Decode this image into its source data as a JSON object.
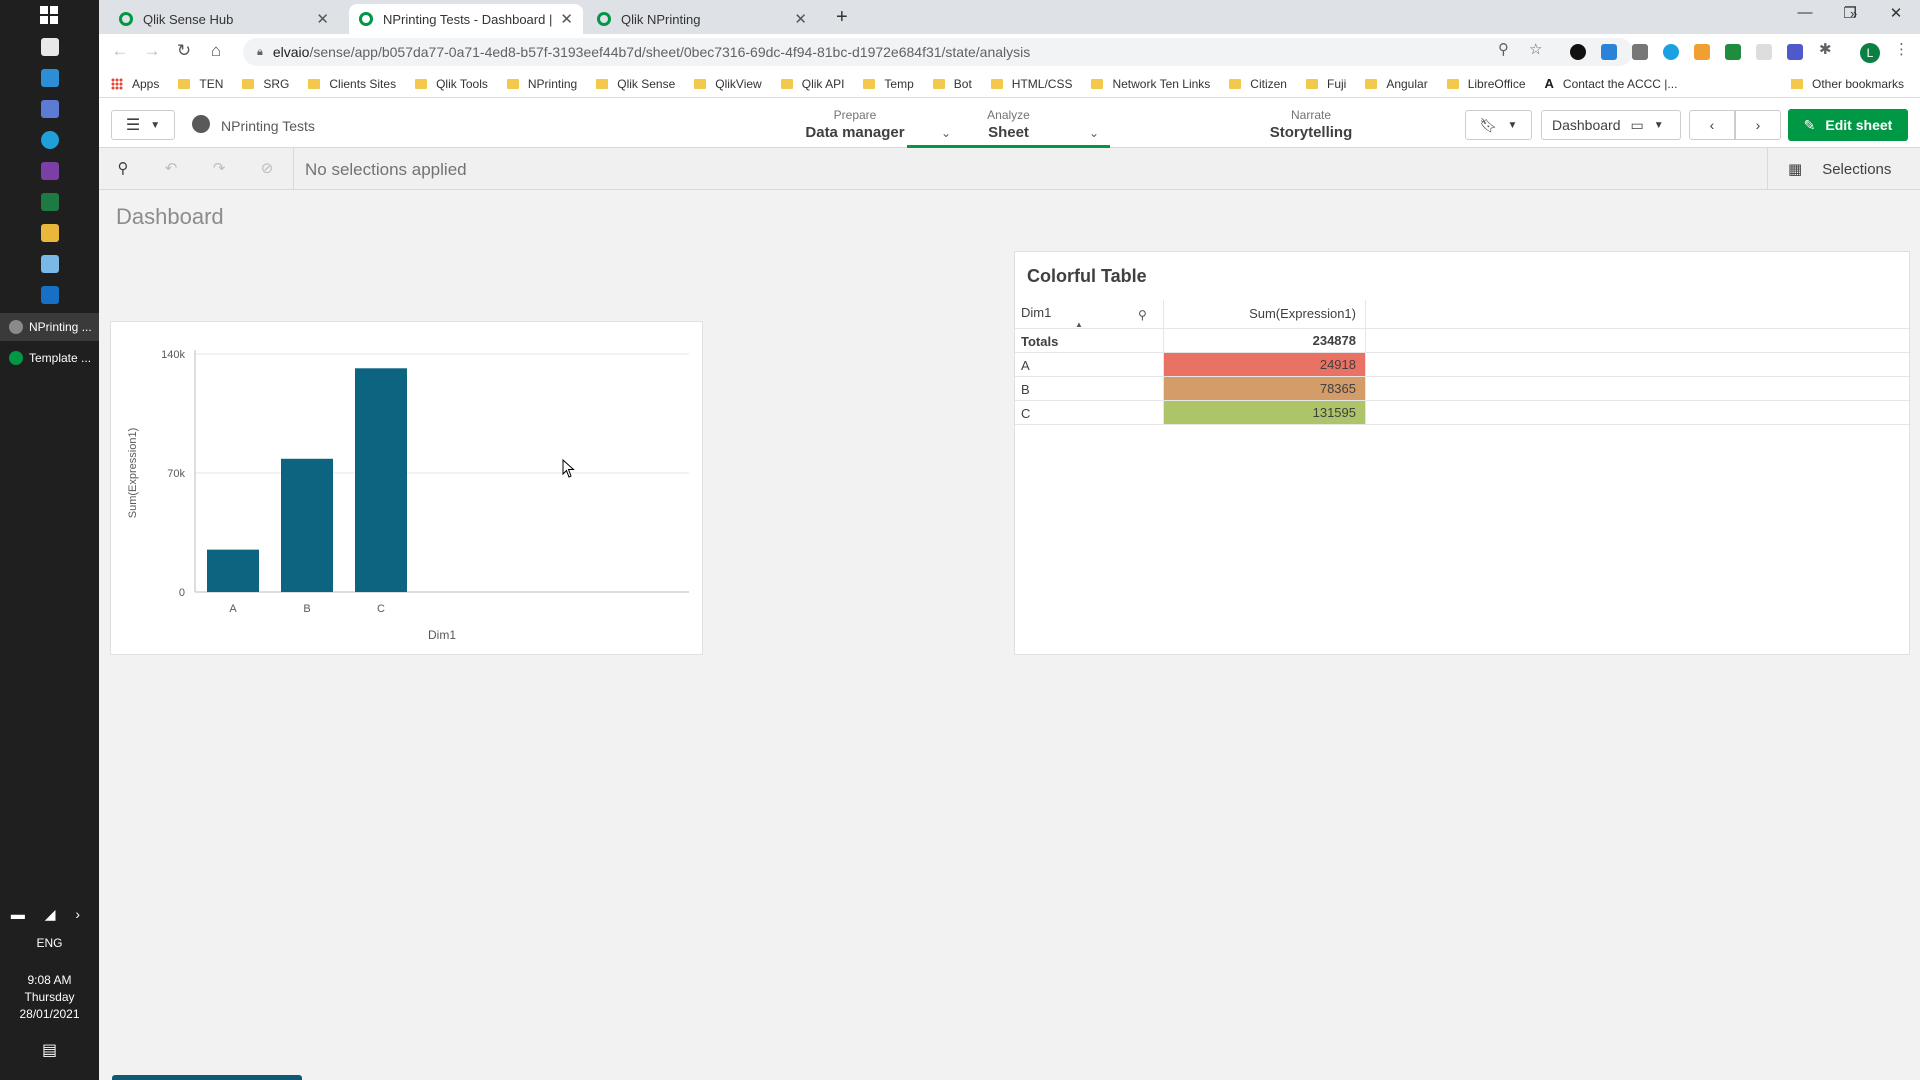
{
  "taskbar": {
    "apps": [
      {
        "label": "NPrinting ..."
      },
      {
        "label": "Template ..."
      }
    ],
    "language": "ENG",
    "time": "9:08 AM",
    "day": "Thursday",
    "date": "28/01/2021"
  },
  "browser": {
    "tabs": [
      {
        "title": "Qlik Sense Hub"
      },
      {
        "title": "NPrinting Tests - Dashboard | Sh"
      },
      {
        "title": "Qlik NPrinting"
      }
    ],
    "url_host": "elvaio",
    "url_path": "/sense/app/b057da77-0a71-4ed8-b57f-3193eef44b7d/sheet/0bec7316-69dc-4f94-81bc-d1972e684f31/state/analysis",
    "bookmarks": [
      "Apps",
      "TEN",
      "SRG",
      "Clients Sites",
      "Qlik Tools",
      "NPrinting",
      "Qlik Sense",
      "QlikView",
      "Qlik API",
      "Temp",
      "Bot",
      "HTML/CSS",
      "Network Ten Links",
      "Citizen",
      "Fuji",
      "Angular",
      "LibreOffice",
      "Contact the ACCC |..."
    ],
    "other_bookmarks": "Other bookmarks",
    "profile_initial": "L"
  },
  "qlik": {
    "app_name": "NPrinting Tests",
    "nav": {
      "prepare_label": "Prepare",
      "prepare_value": "Data manager",
      "analyze_label": "Analyze",
      "analyze_value": "Sheet",
      "narrate_label": "Narrate",
      "narrate_value": "Storytelling"
    },
    "sheet_selector": "Dashboard",
    "edit_label": "Edit sheet",
    "selections_text": "No selections applied",
    "selections_label": "Selections",
    "sheet_title": "Dashboard",
    "accent_color": "#009845"
  },
  "chart_data": {
    "type": "bar",
    "categories": [
      "A",
      "B",
      "C"
    ],
    "values": [
      24918,
      78365,
      131595
    ],
    "xlabel": "Dim1",
    "ylabel": "Sum(Expression1)",
    "ylim": [
      0,
      140000
    ],
    "yticks": [
      "0",
      "70k",
      "140k"
    ],
    "ytick_values": [
      0,
      70000,
      140000
    ],
    "bar_color": "#0d6480",
    "grid": true
  },
  "table": {
    "title": "Colorful Table",
    "col1": "Dim1",
    "col2": "Sum(Expression1)",
    "totals_label": "Totals",
    "totals_value": "234878",
    "rows": [
      {
        "dim": "A",
        "value": "24918",
        "color": "#ea7264"
      },
      {
        "dim": "B",
        "value": "78365",
        "color": "#d49c69"
      },
      {
        "dim": "C",
        "value": "131595",
        "color": "#aec468"
      }
    ]
  }
}
